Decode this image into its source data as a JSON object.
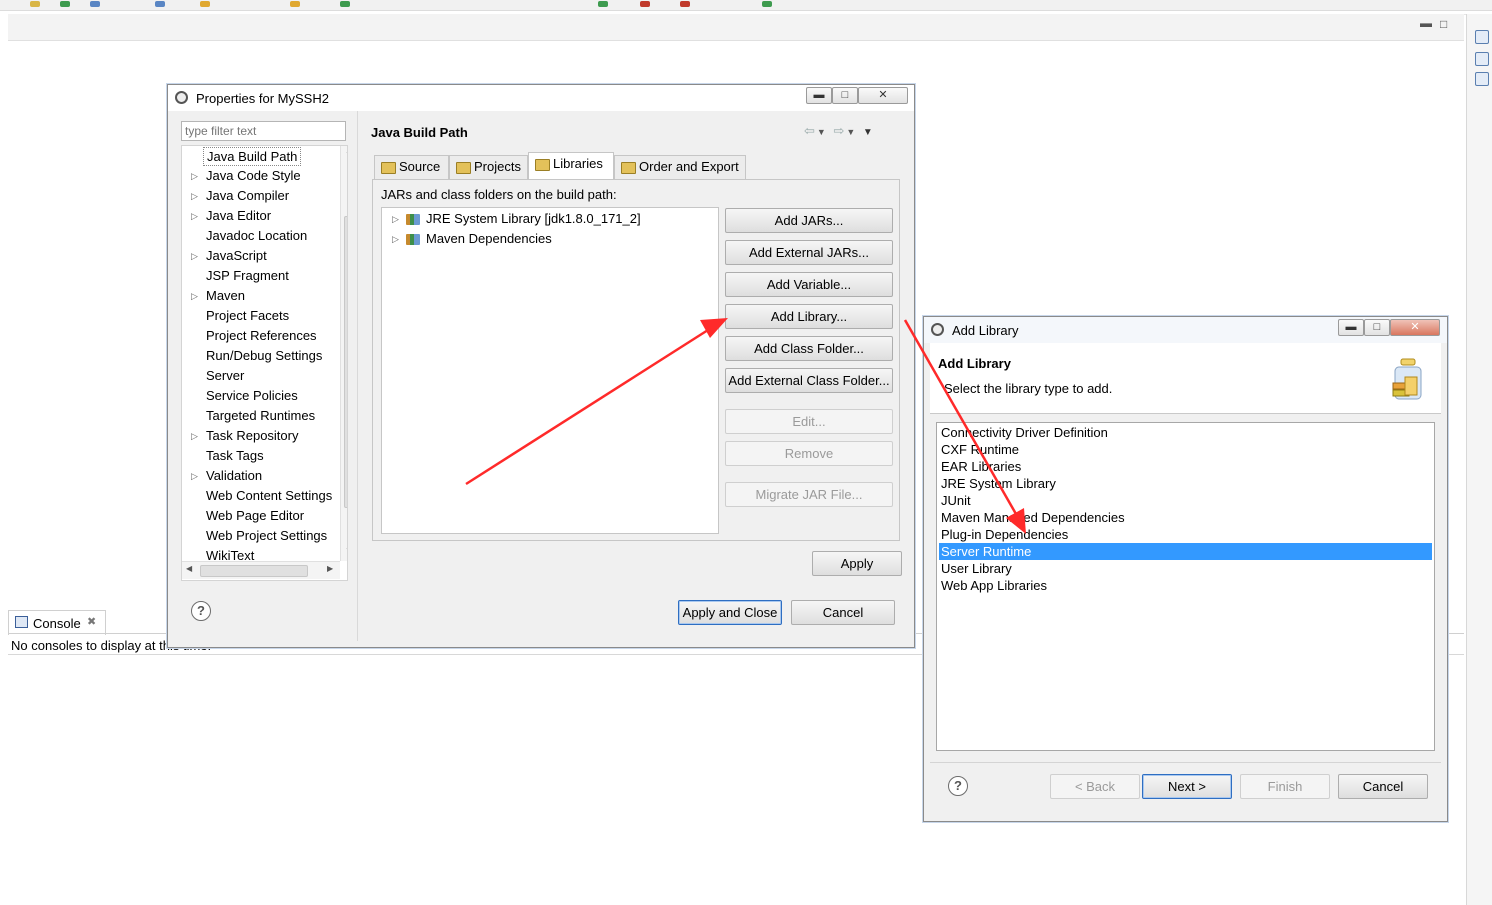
{
  "ide": {
    "console_tab_label": "Console",
    "console_message": "No consoles to display at this time."
  },
  "properties_dialog": {
    "title": "Properties for MySSH2",
    "filter_placeholder": "type filter text",
    "nav_items": [
      {
        "label": "Java Build Path",
        "expandable": false,
        "selected": true
      },
      {
        "label": "Java Code Style",
        "expandable": true
      },
      {
        "label": "Java Compiler",
        "expandable": true
      },
      {
        "label": "Java Editor",
        "expandable": true
      },
      {
        "label": "Javadoc Location",
        "expandable": false
      },
      {
        "label": "JavaScript",
        "expandable": true
      },
      {
        "label": "JSP Fragment",
        "expandable": false
      },
      {
        "label": "Maven",
        "expandable": true
      },
      {
        "label": "Project Facets",
        "expandable": false
      },
      {
        "label": "Project References",
        "expandable": false
      },
      {
        "label": "Run/Debug Settings",
        "expandable": false
      },
      {
        "label": "Server",
        "expandable": false
      },
      {
        "label": "Service Policies",
        "expandable": false
      },
      {
        "label": "Targeted Runtimes",
        "expandable": false
      },
      {
        "label": "Task Repository",
        "expandable": true
      },
      {
        "label": "Task Tags",
        "expandable": false
      },
      {
        "label": "Validation",
        "expandable": true
      },
      {
        "label": "Web Content Settings",
        "expandable": false
      },
      {
        "label": "Web Page Editor",
        "expandable": false
      },
      {
        "label": "Web Project Settings",
        "expandable": false
      },
      {
        "label": "WikiText",
        "expandable": false
      }
    ],
    "page_title": "Java Build Path",
    "tabs": [
      {
        "label": "Source",
        "active": false
      },
      {
        "label": "Projects",
        "active": false
      },
      {
        "label": "Libraries",
        "active": true
      },
      {
        "label": "Order and Export",
        "active": false
      }
    ],
    "panel_label": "JARs and class folders on the build path:",
    "libraries": [
      {
        "label": "JRE System Library [jdk1.8.0_171_2]"
      },
      {
        "label": "Maven Dependencies"
      }
    ],
    "buttons": {
      "add_jars": "Add JARs...",
      "add_external_jars": "Add External JARs...",
      "add_variable": "Add Variable...",
      "add_library": "Add Library...",
      "add_class_folder": "Add Class Folder...",
      "add_external_class_folder": "Add External Class Folder...",
      "edit": "Edit...",
      "remove": "Remove",
      "migrate_jar": "Migrate JAR File...",
      "apply": "Apply",
      "apply_and_close": "Apply and Close",
      "cancel": "Cancel"
    }
  },
  "add_library_dialog": {
    "title": "Add Library",
    "header_title": "Add Library",
    "header_description": "Select the library type to add.",
    "library_types": [
      {
        "label": "Connectivity Driver Definition",
        "selected": false
      },
      {
        "label": "CXF Runtime",
        "selected": false
      },
      {
        "label": "EAR Libraries",
        "selected": false
      },
      {
        "label": "JRE System Library",
        "selected": false
      },
      {
        "label": "JUnit",
        "selected": false
      },
      {
        "label": "Maven Managed Dependencies",
        "selected": false
      },
      {
        "label": "Plug-in Dependencies",
        "selected": false
      },
      {
        "label": "Server Runtime",
        "selected": true
      },
      {
        "label": "User Library",
        "selected": false
      },
      {
        "label": "Web App Libraries",
        "selected": false
      }
    ],
    "buttons": {
      "back": "< Back",
      "next": "Next >",
      "finish": "Finish",
      "cancel": "Cancel"
    }
  },
  "annotation_color": "#ff2a2a",
  "selection_color": "#3399ff"
}
